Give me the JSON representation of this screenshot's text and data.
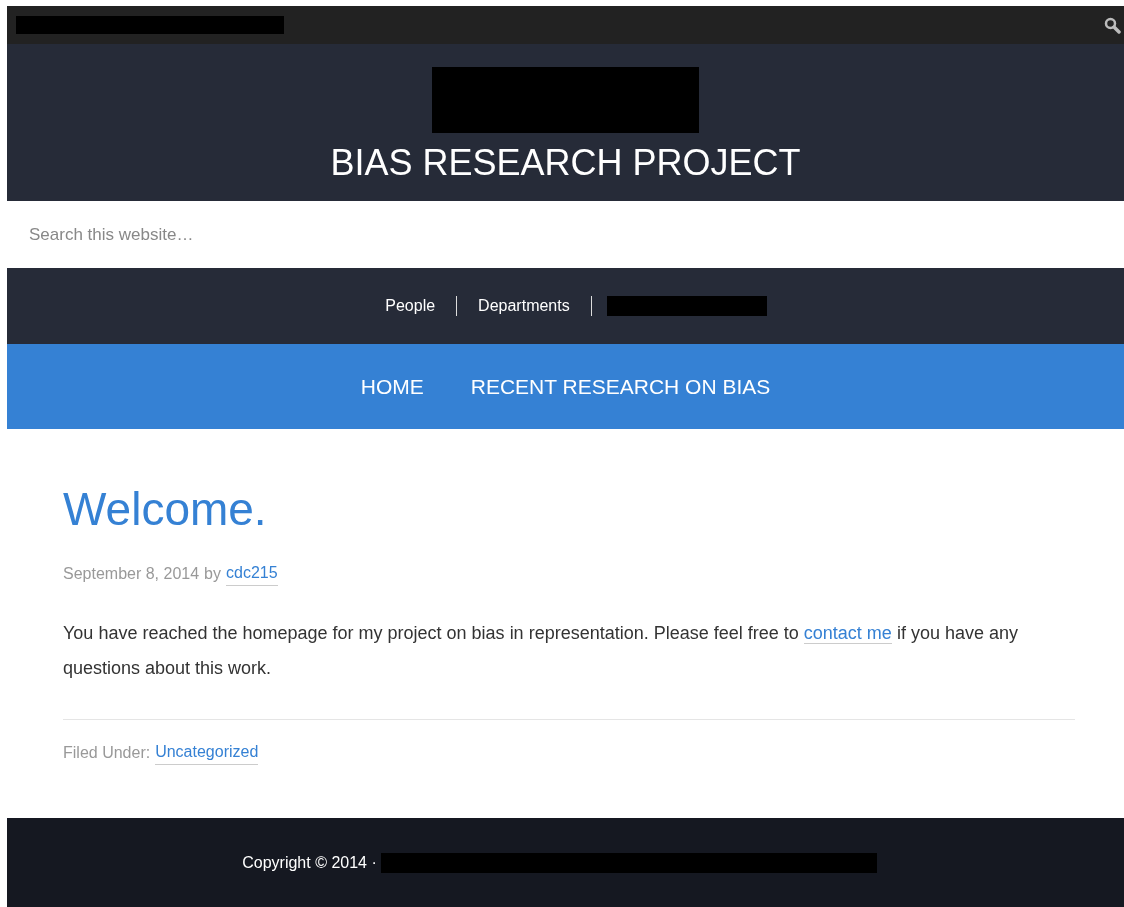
{
  "header": {
    "title": "BIAS RESEARCH PROJECT"
  },
  "search": {
    "placeholder": "Search this website…"
  },
  "secondary_nav": {
    "items": [
      {
        "label": "People"
      },
      {
        "label": "Departments"
      }
    ]
  },
  "primary_nav": {
    "items": [
      {
        "label": "HOME"
      },
      {
        "label": "RECENT RESEARCH ON BIAS"
      }
    ]
  },
  "post": {
    "title": "Welcome.",
    "date": "September 8, 2014",
    "by": "by",
    "author": "cdc215",
    "body_before": "You have reached the homepage for my project on bias in representation. Please feel free to",
    "link": "contact me",
    "body_after": "if you have any questions about this work.",
    "filed_label": "Filed Under:",
    "category": "Uncategorized"
  },
  "footer": {
    "copyright": "Copyright © 2014 ·"
  }
}
